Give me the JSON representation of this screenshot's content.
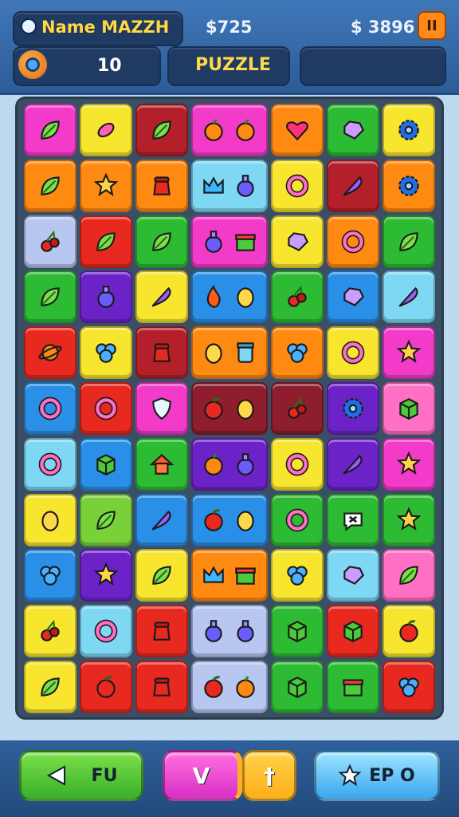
{
  "header": {
    "player_name": "Name MAZZH",
    "money_1": "$725",
    "money_2": "$ 3896",
    "level_value": "10",
    "mode_label": "PUZZLE",
    "pause_glyph": "II"
  },
  "footer": {
    "left_label": "FU",
    "mid_glyph_1": "V",
    "mid_glyph_2": "†",
    "right_label": "EP O"
  },
  "colors": {
    "magenta": "#f23bc8",
    "yellow": "#f7e52e",
    "darkred": "#b3202a",
    "orange": "#ff8a12",
    "green": "#2dbb34",
    "lightblue": "#7ed8f4",
    "red": "#e8291f",
    "blue": "#2a8fe6",
    "purple": "#6b23c7",
    "pink": "#ff6fc4",
    "lavender": "#b8c7f0",
    "maroon": "#8e1d2e",
    "lime": "#79d13a"
  },
  "board": {
    "rows": [
      [
        {
          "bg": "magenta",
          "icons": [
            "leaf-icon"
          ]
        },
        {
          "bg": "yellow",
          "icons": [
            "candy-icon"
          ]
        },
        {
          "bg": "darkred",
          "icons": [
            "leaf-icon"
          ]
        },
        {
          "bg": "magenta",
          "wide": true,
          "icons": [
            "orange-fruit-icon",
            "orange-fruit-icon"
          ]
        },
        {
          "bg": "orange",
          "icons": [
            "heart-icon"
          ]
        },
        {
          "bg": "green",
          "icons": [
            "gem-icon"
          ]
        },
        {
          "bg": "yellow",
          "icons": [
            "gear-icon"
          ]
        }
      ],
      [
        {
          "bg": "orange",
          "icons": [
            "leaf-icon"
          ]
        },
        {
          "bg": "orange",
          "icons": [
            "star-icon"
          ]
        },
        {
          "bg": "orange",
          "icons": [
            "pot-icon"
          ]
        },
        {
          "bg": "lightblue",
          "wide": true,
          "icons": [
            "crown-icon",
            "potion-icon"
          ]
        },
        {
          "bg": "yellow",
          "icons": [
            "ring-icon"
          ]
        },
        {
          "bg": "darkred",
          "icons": [
            "feather-icon"
          ]
        },
        {
          "bg": "orange",
          "icons": [
            "gear-icon"
          ]
        }
      ],
      [
        {
          "bg": "lavender",
          "icons": [
            "cherry-icon"
          ]
        },
        {
          "bg": "red",
          "icons": [
            "leaf-icon"
          ]
        },
        {
          "bg": "green",
          "icons": [
            "leaf-icon"
          ]
        },
        {
          "bg": "magenta",
          "wide": true,
          "icons": [
            "potion-icon",
            "gift-icon"
          ]
        },
        {
          "bg": "yellow",
          "icons": [
            "gem-icon"
          ]
        },
        {
          "bg": "orange",
          "icons": [
            "ring-icon"
          ]
        },
        {
          "bg": "green",
          "icons": [
            "leaf-icon"
          ]
        }
      ],
      [
        {
          "bg": "green",
          "icons": [
            "leaf-icon"
          ]
        },
        {
          "bg": "purple",
          "icons": [
            "potion-icon"
          ]
        },
        {
          "bg": "yellow",
          "icons": [
            "feather-icon"
          ]
        },
        {
          "bg": "blue",
          "wide": true,
          "icons": [
            "flame-icon",
            "lemon-icon"
          ]
        },
        {
          "bg": "green",
          "icons": [
            "cherry-icon"
          ]
        },
        {
          "bg": "blue",
          "icons": [
            "gem-icon"
          ]
        },
        {
          "bg": "lightblue",
          "icons": [
            "feather-icon"
          ]
        }
      ],
      [
        {
          "bg": "red",
          "icons": [
            "planet-icon"
          ]
        },
        {
          "bg": "yellow",
          "icons": [
            "flower-icon"
          ]
        },
        {
          "bg": "darkred",
          "icons": [
            "pot-icon"
          ]
        },
        {
          "bg": "orange",
          "wide": true,
          "icons": [
            "lemon-icon",
            "jar-icon"
          ]
        },
        {
          "bg": "orange",
          "icons": [
            "flower-icon"
          ]
        },
        {
          "bg": "yellow",
          "icons": [
            "ring-icon"
          ]
        },
        {
          "bg": "magenta",
          "icons": [
            "star-icon"
          ]
        }
      ],
      [
        {
          "bg": "blue",
          "icons": [
            "ring-icon"
          ]
        },
        {
          "bg": "red",
          "icons": [
            "ring-icon"
          ]
        },
        {
          "bg": "magenta",
          "icons": [
            "shield-icon"
          ]
        },
        {
          "bg": "maroon",
          "wide": true,
          "icons": [
            "apple-icon",
            "lemon-icon"
          ]
        },
        {
          "bg": "maroon",
          "icons": [
            "cherry-icon"
          ]
        },
        {
          "bg": "purple",
          "icons": [
            "gear-icon"
          ]
        },
        {
          "bg": "pink",
          "icons": [
            "box-icon"
          ]
        }
      ],
      [
        {
          "bg": "lightblue",
          "icons": [
            "ring-icon"
          ]
        },
        {
          "bg": "blue",
          "icons": [
            "box-icon"
          ]
        },
        {
          "bg": "green",
          "icons": [
            "house-icon"
          ]
        },
        {
          "bg": "purple",
          "wide": true,
          "icons": [
            "orange-fruit-icon",
            "potion-icon"
          ]
        },
        {
          "bg": "yellow",
          "icons": [
            "ring-icon"
          ]
        },
        {
          "bg": "purple",
          "icons": [
            "feather-icon"
          ]
        },
        {
          "bg": "magenta",
          "icons": [
            "star-icon"
          ]
        }
      ],
      [
        {
          "bg": "yellow",
          "icons": [
            "lemon-icon"
          ]
        },
        {
          "bg": "lime",
          "icons": [
            "leaf-icon"
          ]
        },
        {
          "bg": "blue",
          "icons": [
            "feather-icon"
          ]
        },
        {
          "bg": "blue",
          "wide": true,
          "icons": [
            "apple-icon",
            "lemon-icon"
          ]
        },
        {
          "bg": "green",
          "icons": [
            "ring-icon"
          ]
        },
        {
          "bg": "green",
          "icons": [
            "bubble-icon"
          ]
        },
        {
          "bg": "green",
          "icons": [
            "star-icon"
          ]
        }
      ],
      [
        {
          "bg": "blue",
          "icons": [
            "flower-icon"
          ]
        },
        {
          "bg": "purple",
          "icons": [
            "star-icon"
          ]
        },
        {
          "bg": "yellow",
          "icons": [
            "leaf-icon"
          ]
        },
        {
          "bg": "orange",
          "wide": true,
          "icons": [
            "crown-icon",
            "gift-icon"
          ]
        },
        {
          "bg": "yellow",
          "icons": [
            "flower-icon"
          ]
        },
        {
          "bg": "lightblue",
          "icons": [
            "gem-icon"
          ]
        },
        {
          "bg": "pink",
          "icons": [
            "leaf-icon"
          ]
        }
      ],
      [
        {
          "bg": "yellow",
          "icons": [
            "cherry-icon"
          ]
        },
        {
          "bg": "lightblue",
          "icons": [
            "ring-icon"
          ]
        },
        {
          "bg": "red",
          "icons": [
            "pot-icon"
          ]
        },
        {
          "bg": "lavender",
          "wide": true,
          "icons": [
            "potion-icon",
            "potion-icon"
          ]
        },
        {
          "bg": "green",
          "icons": [
            "box-icon"
          ]
        },
        {
          "bg": "red",
          "icons": [
            "box-icon"
          ]
        },
        {
          "bg": "yellow",
          "icons": [
            "apple-icon"
          ]
        }
      ],
      [
        {
          "bg": "yellow",
          "icons": [
            "leaf-icon"
          ]
        },
        {
          "bg": "red",
          "icons": [
            "apple-icon"
          ]
        },
        {
          "bg": "red",
          "icons": [
            "pot-icon"
          ]
        },
        {
          "bg": "lavender",
          "wide": true,
          "icons": [
            "apple-icon",
            "orange-fruit-icon"
          ]
        },
        {
          "bg": "green",
          "icons": [
            "box-icon"
          ]
        },
        {
          "bg": "green",
          "icons": [
            "gift-icon"
          ]
        },
        {
          "bg": "red",
          "icons": [
            "flower-icon"
          ]
        }
      ]
    ]
  }
}
